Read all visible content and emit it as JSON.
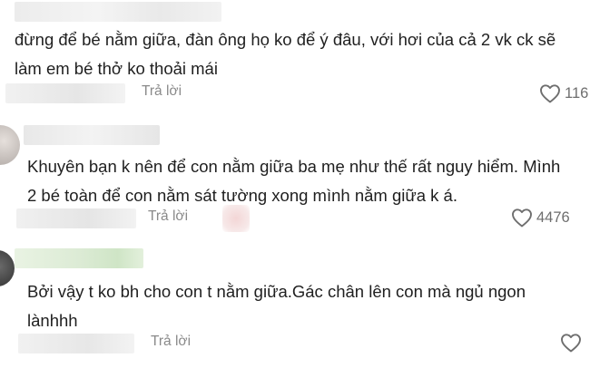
{
  "comments": [
    {
      "text": "đừng để bé nằm giữa, đàn ông họ ko để ý đâu, với hơi của cả 2 vk ck sẽ\nlàm em bé thở ko thoải mái",
      "reply_label": "Trả lời",
      "likes": "116",
      "like_icon": "heart-outline-icon"
    },
    {
      "text": "Khuyên bạn k nên để con nằm giữa ba mẹ như thế rất nguy hiểm. Mình\n2 bé toàn để con nằm sát tường xong mình nằm giữa k á.",
      "reply_label": "Trả lời",
      "likes": "4476",
      "like_icon": "heart-outline-icon"
    },
    {
      "text": "Bởi vậy t ko bh cho con t nằm giữa.Gác chân lên con mà ngủ ngon\nlànhhh",
      "reply_label": "Trả lời",
      "likes": "",
      "like_icon": "heart-outline-icon"
    }
  ]
}
